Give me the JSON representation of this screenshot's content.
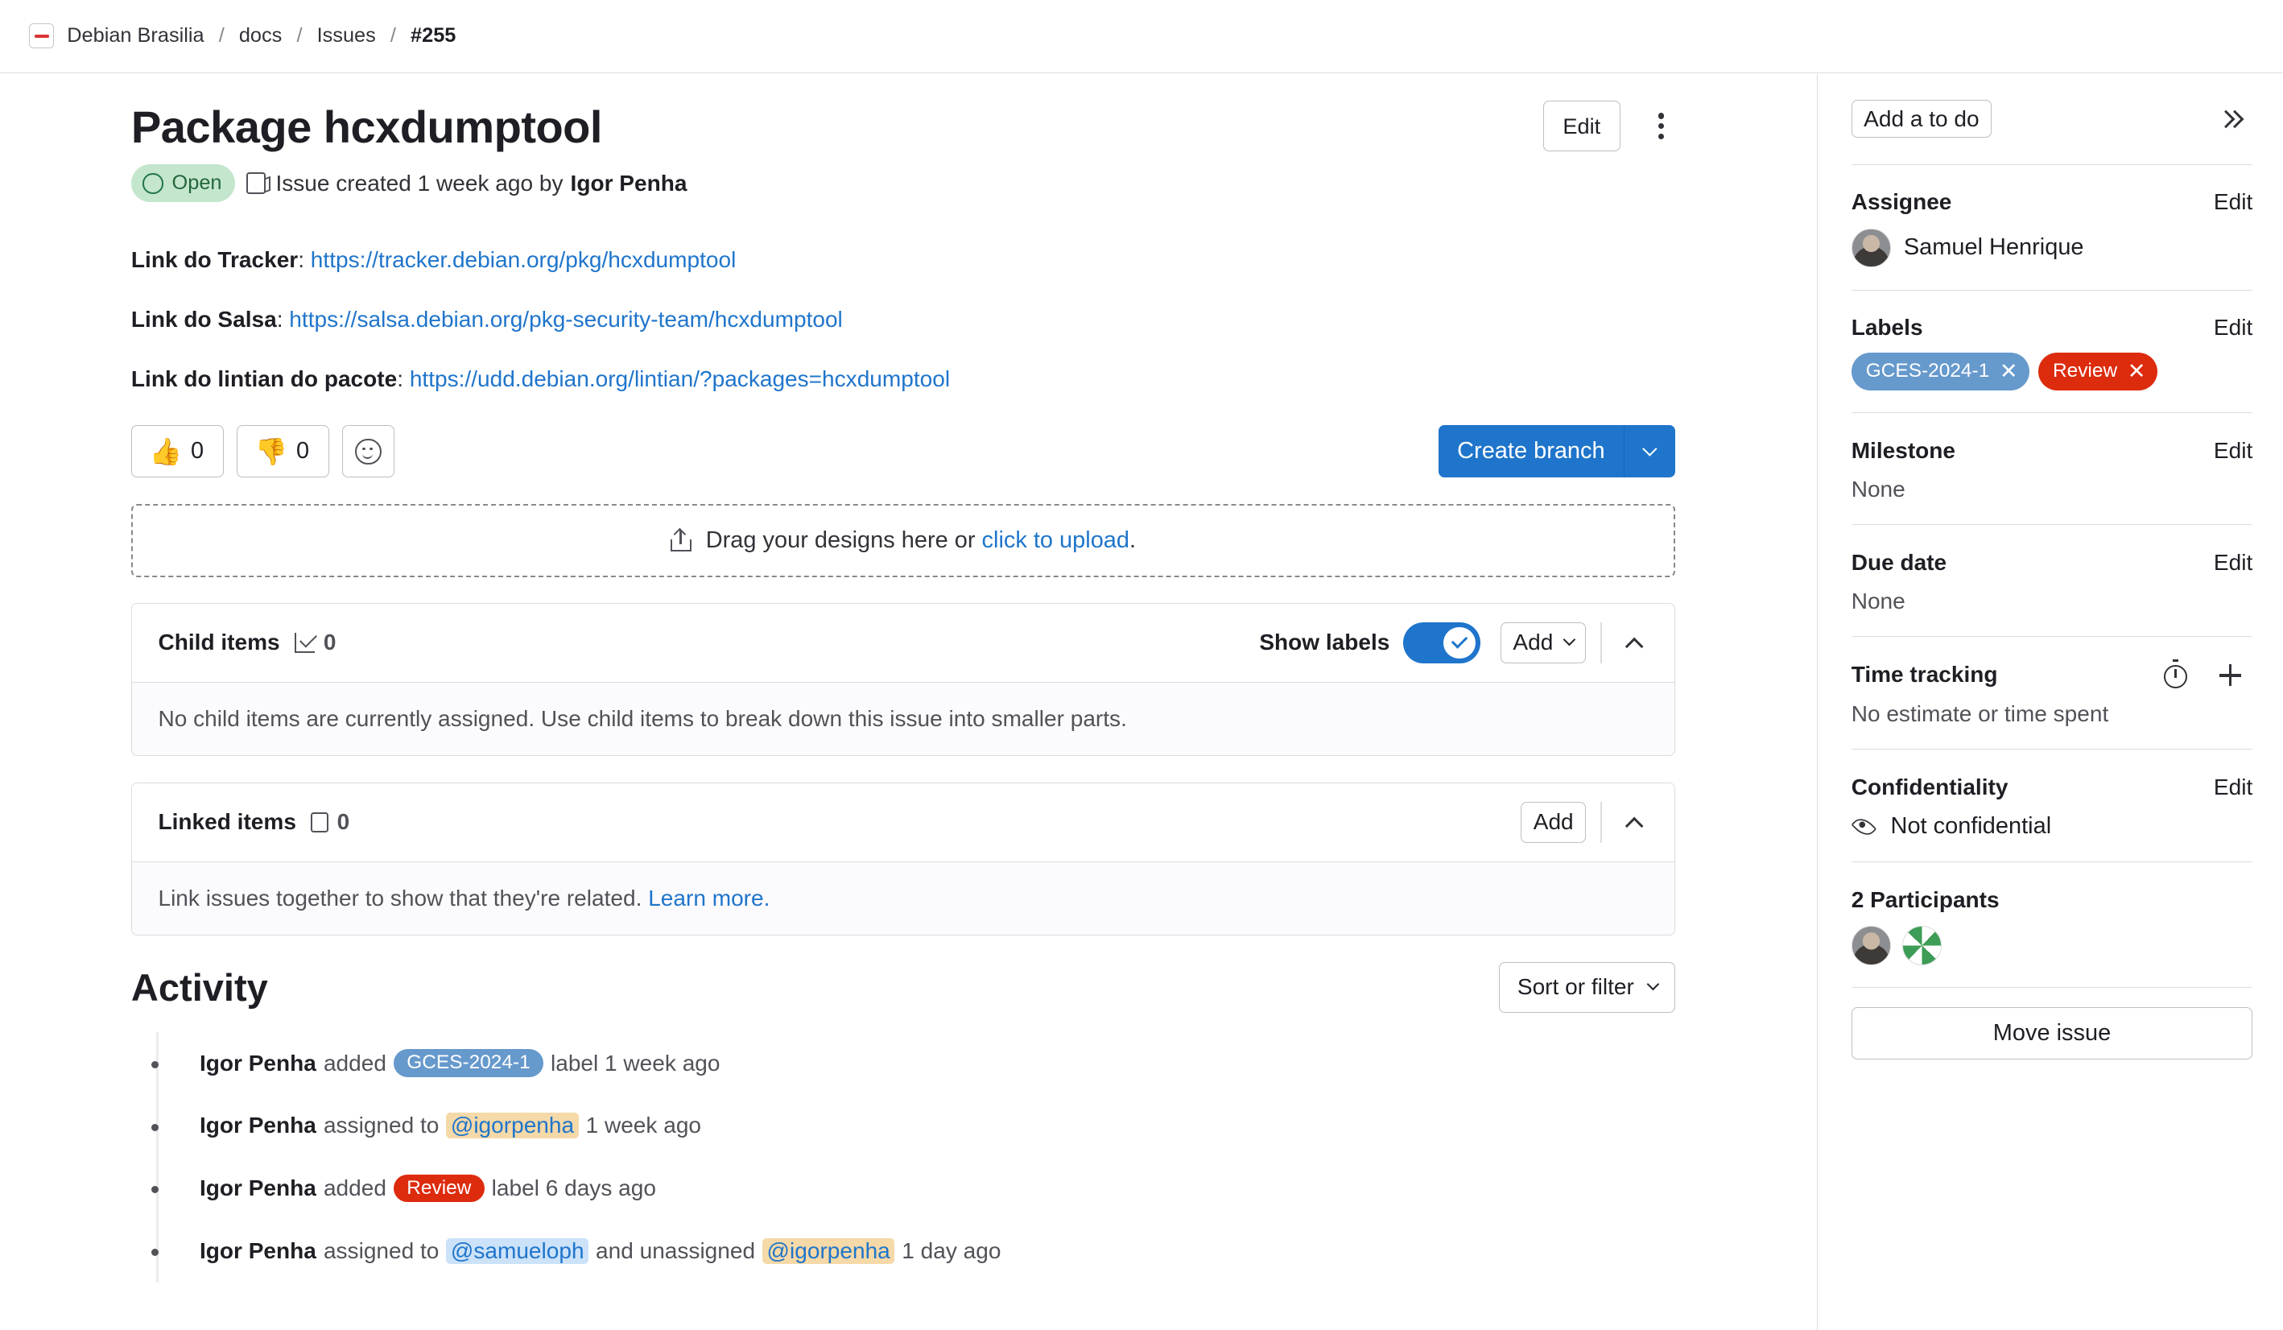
{
  "breadcrumb": {
    "items": [
      "Debian Brasilia",
      "docs",
      "Issues"
    ],
    "current": "#255",
    "separator": "/"
  },
  "issue": {
    "title": "Package hcxdumptool",
    "edit_label": "Edit",
    "status": "Open",
    "created_text": "Issue created 1 week ago by",
    "author": "Igor Penha"
  },
  "description": [
    {
      "label": "Link do Tracker",
      "url": "https://tracker.debian.org/pkg/hcxdumptool"
    },
    {
      "label": "Link do Salsa",
      "url": "https://salsa.debian.org/pkg-security-team/hcxdumptool"
    },
    {
      "label": "Link do lintian do pacote",
      "url": "https://udd.debian.org/lintian/?packages=hcxdumptool"
    }
  ],
  "awards": {
    "thumbs_up": {
      "emoji": "👍",
      "count": "0"
    },
    "thumbs_down": {
      "emoji": "👎",
      "count": "0"
    }
  },
  "create_branch_label": "Create branch",
  "dropzone": {
    "text": "Drag your designs here or",
    "link": "click to upload",
    "suffix": "."
  },
  "child_items": {
    "title": "Child items",
    "count": "0",
    "show_labels": "Show labels",
    "add_label": "Add",
    "empty_text": "No child items are currently assigned. Use child items to break down this issue into smaller parts."
  },
  "linked_items": {
    "title": "Linked items",
    "count": "0",
    "add_label": "Add",
    "empty_text": "Link issues together to show that they're related.",
    "learn_more": "Learn more."
  },
  "activity": {
    "title": "Activity",
    "sort_label": "Sort or filter",
    "events": [
      {
        "who": "Igor Penha",
        "verb": "added",
        "label": "GCES-2024-1",
        "suffix": "label 1 week ago"
      },
      {
        "who": "Igor Penha",
        "verb": "assigned to",
        "mention": "@igorpenha",
        "suffix": "1 week ago"
      },
      {
        "who": "Igor Penha",
        "verb": "added",
        "label": "Review",
        "suffix": "label 6 days ago"
      },
      {
        "who": "Igor Penha",
        "verb": "assigned to",
        "mention": "@samueloph",
        "middle": "and unassigned",
        "mention2": "@igorpenha",
        "suffix": "1 day ago"
      }
    ]
  },
  "sidebar": {
    "todo_label": "Add a to do",
    "edit_label": "Edit",
    "assignee": {
      "title": "Assignee",
      "name": "Samuel Henrique"
    },
    "labels": {
      "title": "Labels",
      "items": [
        {
          "name": "GCES-2024-1",
          "color": "#6699cc"
        },
        {
          "name": "Review",
          "color": "#dd2b0e"
        }
      ]
    },
    "milestone": {
      "title": "Milestone",
      "value": "None"
    },
    "due_date": {
      "title": "Due date",
      "value": "None"
    },
    "time_tracking": {
      "title": "Time tracking",
      "value": "No estimate or time spent"
    },
    "confidentiality": {
      "title": "Confidentiality",
      "value": "Not confidential"
    },
    "participants": {
      "title": "2 Participants"
    },
    "move_label": "Move issue"
  },
  "colors": {
    "accent": "#1f75cb",
    "label_gces": "#6699cc",
    "label_review": "#dd2b0e",
    "open_badge_bg": "#c3e6cd"
  }
}
